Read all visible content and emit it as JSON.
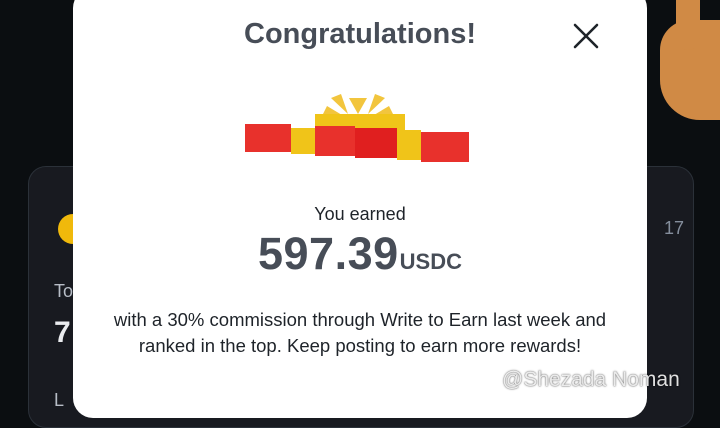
{
  "background": {
    "to_fragment": "To",
    "value_fragment": "7",
    "date_fragment": "17",
    "last_fragment": "L"
  },
  "modal": {
    "title": "Congratulations!",
    "close_icon": "close-icon",
    "gift_icon": "gift-icon",
    "earned_label": "You earned",
    "amount": "597.39",
    "currency": "USDC",
    "description": "with a 30% commission through Write to Earn last week and ranked in the top. Keep posting to earn more rewards!"
  },
  "watermark": {
    "text": "@Shezada Noman",
    "logo_icon": "binance-logo-icon"
  },
  "colors": {
    "modal_bg": "#ffffff",
    "page_bg": "#0b0e11",
    "gift_red": "#e8312c",
    "gift_gold": "#f0c419",
    "title_text": "#474d57"
  }
}
